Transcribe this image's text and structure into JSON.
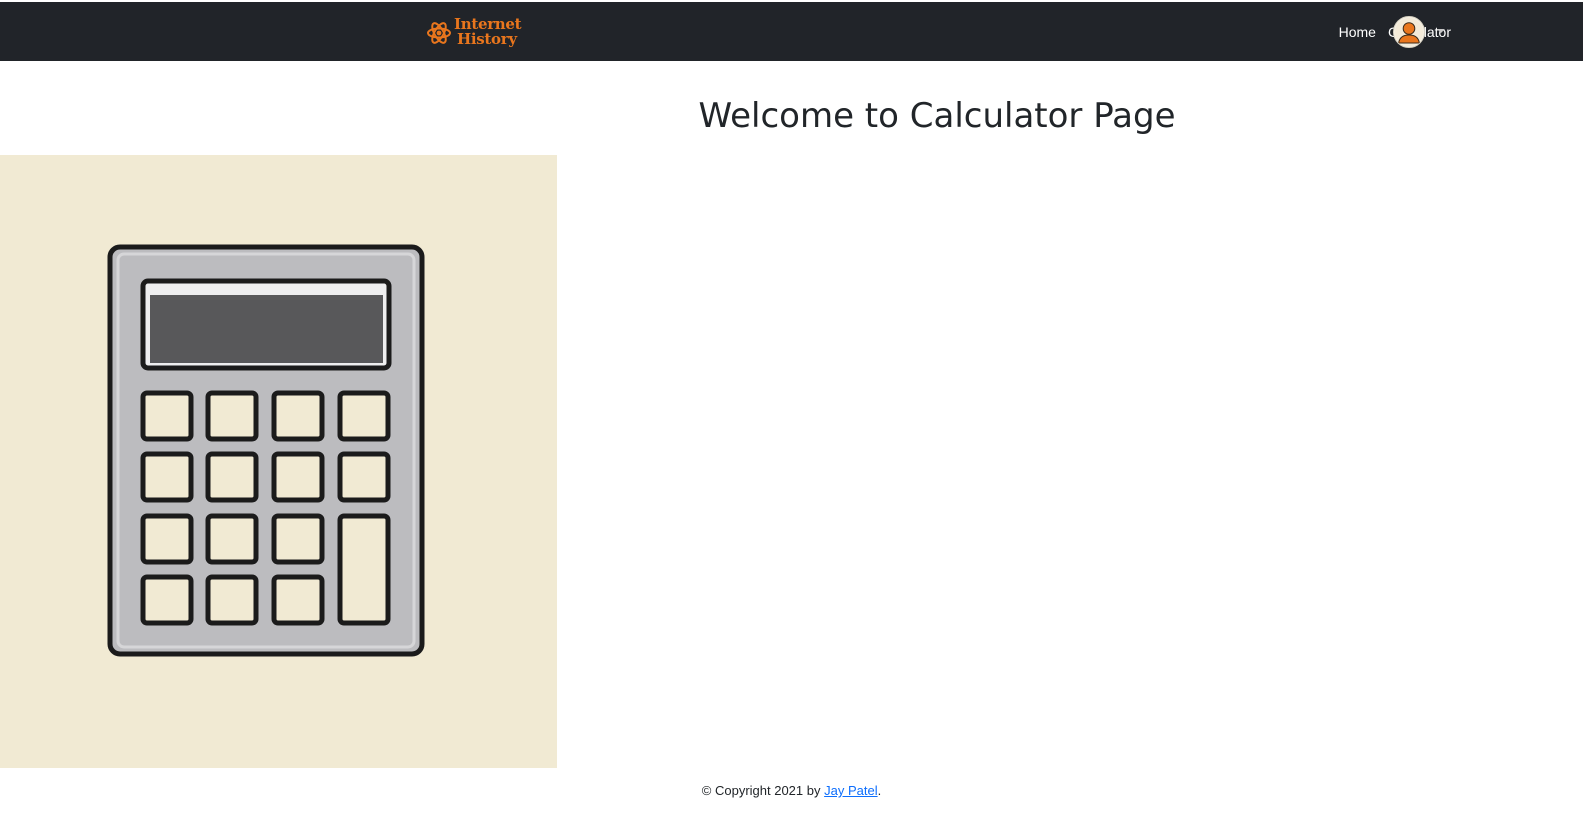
{
  "navbar": {
    "logo": {
      "line1": "Internet",
      "line2": "History",
      "icon": "atom-icon",
      "color": "#e9761d"
    },
    "links": [
      {
        "label": "Home"
      },
      {
        "label": "Calculator"
      }
    ],
    "user_icon": "user-avatar-icon",
    "dropdown_icon": "caret-down-icon",
    "background": "#212429"
  },
  "main": {
    "title": "Welcome to Calculator Page",
    "hero_image": {
      "icon": "calculator-icon",
      "background": "#f1ead3"
    }
  },
  "footer": {
    "prefix": "© Copyright 2021 by ",
    "author_link": "Jay Patel",
    "suffix": ".",
    "link_color": "#0d6efd"
  }
}
